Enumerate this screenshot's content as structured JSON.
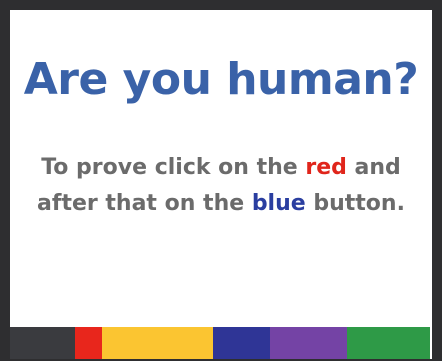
{
  "captcha": {
    "title": "Are you human?",
    "instruction": {
      "line1_prefix": "To prove click on the ",
      "red_word": "red",
      "line1_suffix": " and",
      "line2_prefix": "after that on the ",
      "blue_word": "blue",
      "line2_suffix": " button."
    },
    "colors": {
      "title": "#3a62a8",
      "text": "#6b6b6b",
      "red_word": "#e0251b",
      "blue_word": "#2a3ea0",
      "frame": "#2e2e30"
    },
    "buttons": [
      {
        "color_name": "dark-gray",
        "color": "#3a3b3f"
      },
      {
        "color_name": "red",
        "color": "#e8261c"
      },
      {
        "color_name": "yellow",
        "color": "#fbc531"
      },
      {
        "color_name": "navy",
        "color": "#2f3596"
      },
      {
        "color_name": "purple",
        "color": "#7443a5"
      },
      {
        "color_name": "green",
        "color": "#2e9a47"
      }
    ]
  }
}
